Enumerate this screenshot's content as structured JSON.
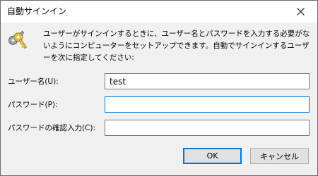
{
  "window": {
    "title": "自動サインイン"
  },
  "description": "ユーザーがサインインするときに、ユーザー名とパスワードを入力する必要がないようにコンピューターをセットアップできます。自動でサインインするユーザーを次に指定してください:",
  "form": {
    "username": {
      "label": "ユーザー名(U):",
      "value": "test"
    },
    "password": {
      "label": "パスワード(P):",
      "value": ""
    },
    "confirm": {
      "label": "パスワードの確認入力(C):",
      "value": ""
    }
  },
  "buttons": {
    "ok": "OK",
    "cancel": "キャンセル"
  },
  "icons": {
    "close": "close-icon",
    "keys": "keys-icon"
  },
  "colors": {
    "accent": "#0078d7",
    "window_bg": "#f0f0f0",
    "titlebar_bg": "#ffffff",
    "key_gold": "#d9b233",
    "key_gray": "#8a8f96"
  }
}
